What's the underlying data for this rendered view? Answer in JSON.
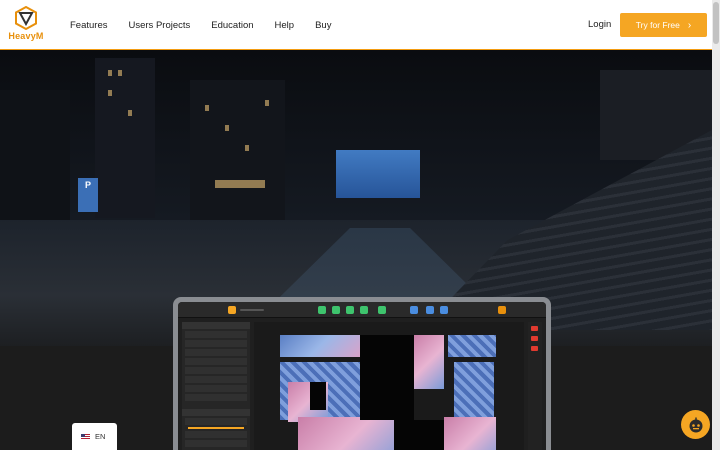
{
  "brand": {
    "name": "HeavyM",
    "accent": "#f5a623"
  },
  "nav": {
    "items": [
      {
        "label": "Features"
      },
      {
        "label": "Users Projects"
      },
      {
        "label": "Education"
      },
      {
        "label": "Help"
      },
      {
        "label": "Buy"
      }
    ],
    "login": "Login",
    "cta": "Try for Free",
    "cta_icon": "chevron-right-icon"
  },
  "hero": {
    "parking_sign": "P"
  },
  "language": {
    "label": "EN",
    "flag": "us-flag-icon"
  },
  "chat": {
    "icon": "chat-bot-icon"
  }
}
